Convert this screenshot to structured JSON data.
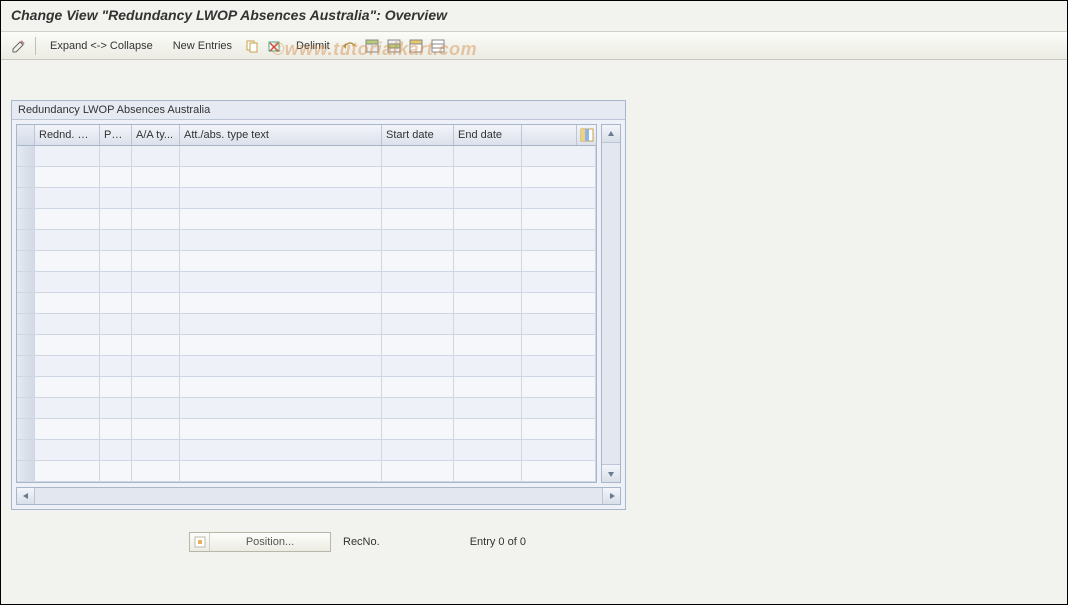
{
  "title": "Change View \"Redundancy LWOP Absences Australia\": Overview",
  "toolbar": {
    "expand_collapse_label": "Expand <-> Collapse",
    "new_entries_label": "New Entries",
    "delimit_label": "Delimit"
  },
  "panel": {
    "title": "Redundancy LWOP Absences Australia",
    "columns": [
      "Rednd. M...",
      "PSG",
      "A/A ty...",
      "Att./abs. type text",
      "Start date",
      "End date"
    ],
    "rows": [
      {},
      {},
      {},
      {},
      {},
      {},
      {},
      {},
      {},
      {},
      {},
      {},
      {},
      {},
      {},
      {}
    ]
  },
  "footer": {
    "position_label": "Position...",
    "recno_label": "RecNo.",
    "entry_label": "Entry 0 of 0"
  },
  "watermark": "©www.tutorialkart.com",
  "icons": {
    "pencil": "pencil-icon",
    "copy": "copy-icon",
    "delete": "delete-icon",
    "undo": "undo-icon",
    "select_all": "select-all-icon",
    "select_block": "select-block-icon",
    "deselect": "deselect-icon",
    "deselect_all": "deselect-all-icon",
    "settings": "table-settings-icon",
    "up_arrow": "scroll-up-icon",
    "down_arrow": "scroll-down-icon",
    "left_arrow": "scroll-left-icon",
    "right_arrow": "scroll-right-icon",
    "locate": "locate-icon"
  },
  "colors": {
    "header_grad_top": "#f3f5fa",
    "header_grad_bottom": "#dbe1eb",
    "panel_border": "#a9b5c9",
    "bg": "#f2f2ee"
  }
}
